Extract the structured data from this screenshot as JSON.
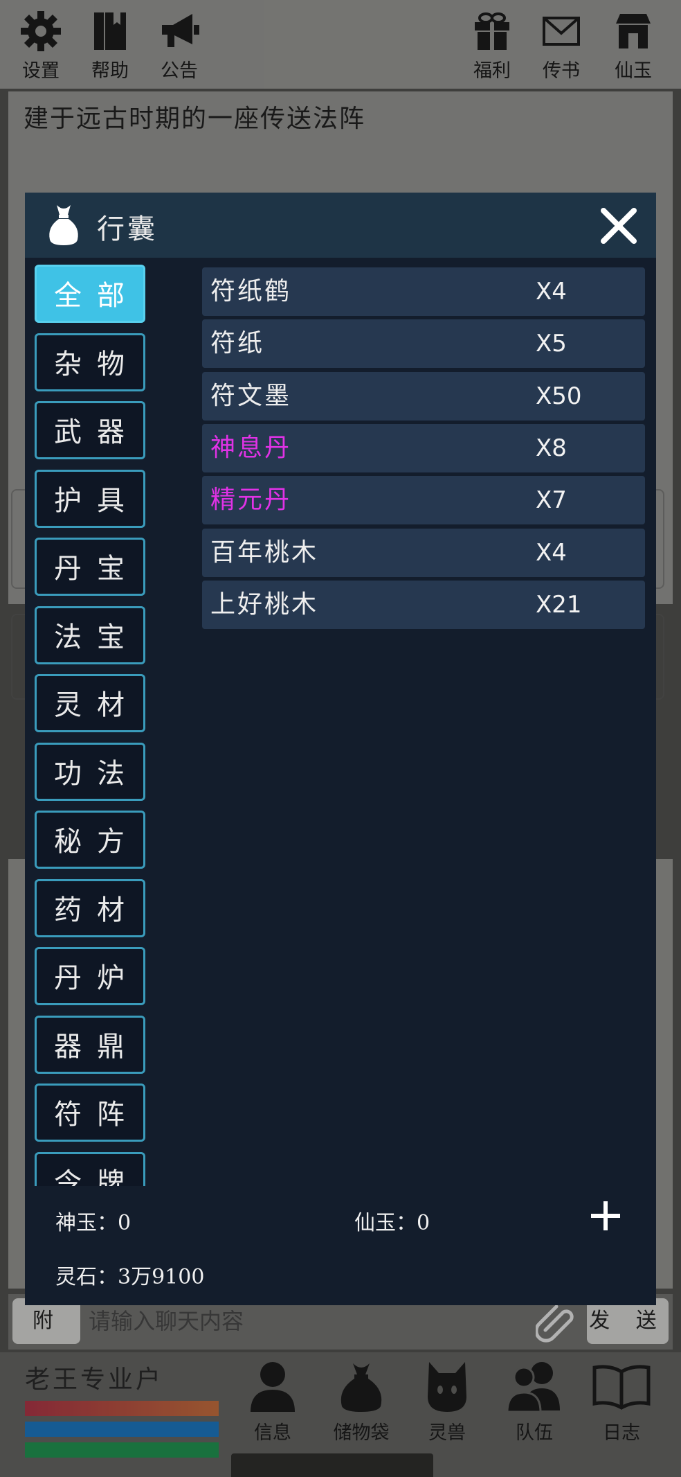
{
  "topbar": {
    "left": [
      {
        "label": "设置",
        "icon": "gear-icon"
      },
      {
        "label": "帮助",
        "icon": "book-icon"
      },
      {
        "label": "公告",
        "icon": "megaphone-icon"
      }
    ],
    "right": [
      {
        "label": "福利",
        "icon": "gift-icon"
      },
      {
        "label": "传书",
        "icon": "mail-icon"
      },
      {
        "label": "仙玉",
        "icon": "shop-icon"
      }
    ]
  },
  "scene": {
    "description": "建于远古时期的一座传送法阵"
  },
  "dialog": {
    "title": "行囊",
    "categories": [
      "全部",
      "杂物",
      "武器",
      "护具",
      "丹宝",
      "法宝",
      "灵材",
      "功法",
      "秘方",
      "药材",
      "丹炉",
      "器鼎",
      "符阵",
      "令牌"
    ],
    "active_category": "全部",
    "items": [
      {
        "name": "符纸鹤",
        "count": "X4",
        "rare": false
      },
      {
        "name": "符纸",
        "count": "X5",
        "rare": false
      },
      {
        "name": "符文墨",
        "count": "X50",
        "rare": false
      },
      {
        "name": "神息丹",
        "count": "X8",
        "rare": true
      },
      {
        "name": "精元丹",
        "count": "X7",
        "rare": true
      },
      {
        "name": "百年桃木",
        "count": "X4",
        "rare": false
      },
      {
        "name": "上好桃木",
        "count": "X21",
        "rare": false
      }
    ],
    "currency": {
      "shenyu": "神玉：0",
      "xianyu": "仙玉：0",
      "lingshi": "灵石：3万9100"
    },
    "colors": {
      "active_tab": "#3fc2e6",
      "rare_item": "#e032e6",
      "header": "#1e3446"
    }
  },
  "chat": {
    "channel": "附 近",
    "placeholder": "请输入聊天内容",
    "send_label": "发 送"
  },
  "player": {
    "name": "老王专业户"
  },
  "bottom_nav": [
    {
      "label": "信息",
      "icon": "person-icon"
    },
    {
      "label": "储物袋",
      "icon": "bag-icon"
    },
    {
      "label": "灵兽",
      "icon": "cat-icon"
    },
    {
      "label": "队伍",
      "icon": "team-icon"
    },
    {
      "label": "日志",
      "icon": "open-book-icon"
    }
  ]
}
